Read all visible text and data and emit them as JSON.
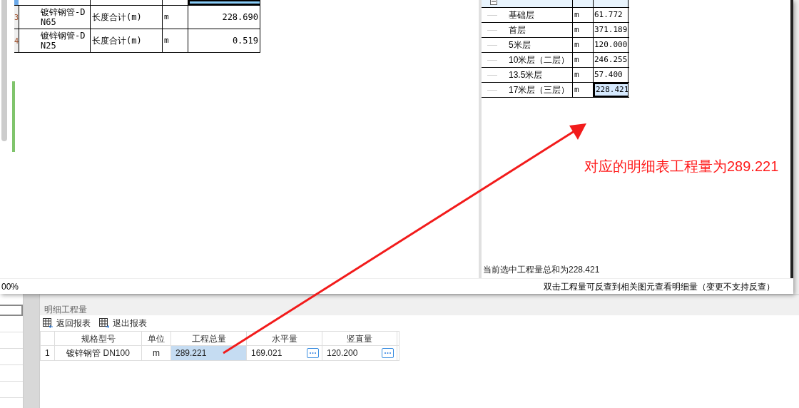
{
  "popup": {
    "left_table": {
      "rows": [
        {
          "index": "",
          "name": "",
          "measure": "",
          "unit": "",
          "value": "",
          "selected": true
        },
        {
          "index": "3",
          "name": "镀锌钢管-DN65",
          "measure": "长度合计(m)",
          "unit": "m",
          "value": "228.690",
          "selected": false
        },
        {
          "index": "4",
          "name": "镀锌钢管-DN25",
          "measure": "长度合计(m)",
          "unit": "m",
          "value": "0.519",
          "selected": false
        }
      ]
    },
    "tree_table": {
      "expanded": true,
      "rows": [
        {
          "name": "基础层",
          "unit": "m",
          "value": "61.772",
          "selected": false
        },
        {
          "name": "首层",
          "unit": "m",
          "value": "371.189",
          "selected": false
        },
        {
          "name": "5米层",
          "unit": "m",
          "value": "120.000",
          "selected": false
        },
        {
          "name": "10米层（二层）",
          "unit": "m",
          "value": "246.255",
          "selected": false
        },
        {
          "name": "13.5米层",
          "unit": "m",
          "value": "57.400",
          "selected": false
        },
        {
          "name": "17米层（三层）",
          "unit": "m",
          "value": "228.421",
          "selected": true
        }
      ]
    },
    "selection_sum": "当前选中工程量总和为228.421",
    "zoom_level": "00%",
    "hint": "双击工程量可反查到相关图元查看明细量（变更不支持反查）"
  },
  "annotation": "对应的明细表工程量为289.221",
  "detail_panel": {
    "title": "明细工程量",
    "toolbar": [
      "返回报表",
      "退出报表"
    ],
    "columns": [
      "规格型号",
      "单位",
      "工程总量",
      "水平量",
      "竖直量"
    ],
    "rows": [
      {
        "index": "1",
        "cells": [
          {
            "text": "镀锌钢管 DN100",
            "selected": false,
            "more_button": false
          },
          {
            "text": "m",
            "selected": false,
            "more_button": false
          },
          {
            "text": "289.221",
            "selected": true,
            "more_button": false
          },
          {
            "text": "169.021",
            "selected": false,
            "more_button": true
          },
          {
            "text": "120.200",
            "selected": false,
            "more_button": true
          }
        ]
      }
    ]
  }
}
